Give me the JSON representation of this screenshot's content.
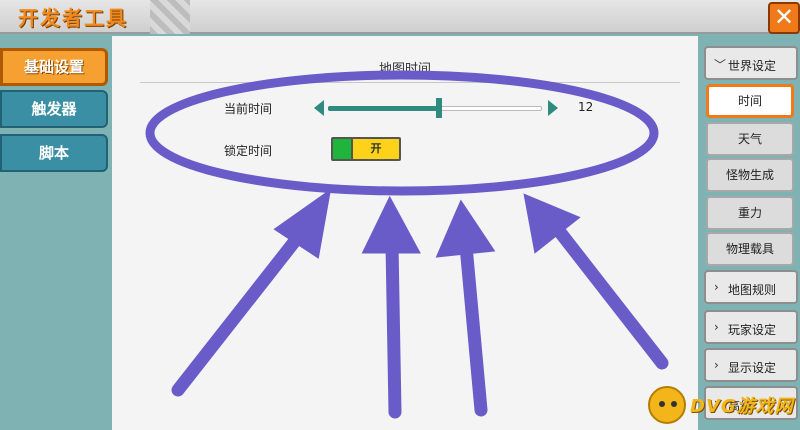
{
  "window": {
    "title": "开发者工具",
    "close_label": "✕",
    "status_text": ""
  },
  "left_tabs": [
    {
      "label": "基础设置",
      "active": true
    },
    {
      "label": "触发器",
      "active": false
    },
    {
      "label": "脚本",
      "active": false
    }
  ],
  "main": {
    "section_title": "地图时间",
    "current_time": {
      "label": "当前时间",
      "value": 12,
      "slider_fraction": 0.52
    },
    "lock_time": {
      "label": "锁定时间",
      "toggle_label": "开",
      "on": true
    }
  },
  "right_menu": {
    "groups": [
      {
        "label": "世界设定",
        "expanded": true,
        "chevron": "chevron-down-icon",
        "items": [
          {
            "label": "时间",
            "active": true
          },
          {
            "label": "天气",
            "active": false
          },
          {
            "label": "怪物生成",
            "active": false
          },
          {
            "label": "重力",
            "active": false
          },
          {
            "label": "物理载具",
            "active": false
          }
        ]
      },
      {
        "label": "地图规则",
        "expanded": false,
        "chevron": "chevron-right-icon"
      },
      {
        "label": "玩家设定",
        "expanded": false,
        "chevron": "chevron-right-icon"
      },
      {
        "label": "显示设定",
        "expanded": false,
        "chevron": "chevron-right-icon"
      },
      {
        "label": "高级",
        "expanded": false,
        "chevron": "chevron-right-icon"
      }
    ]
  },
  "annotation": {
    "color": "#6a5cc8"
  },
  "watermark": {
    "text": "DVG游戏网"
  },
  "colors": {
    "accent": "#f07a1a",
    "slider": "#2f8a80",
    "toggle_on": "#1fb53a",
    "toggle_bg": "#ffd21a"
  }
}
